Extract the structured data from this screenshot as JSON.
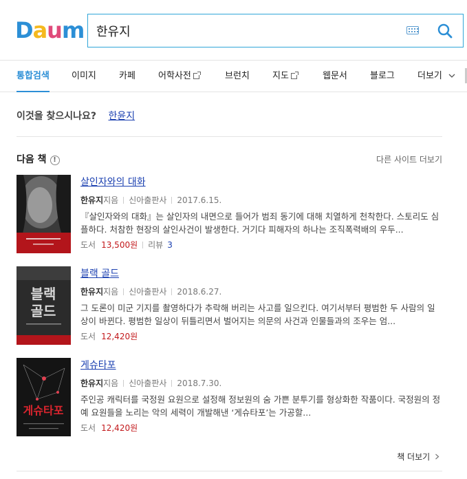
{
  "logo": {
    "letters": [
      "D",
      "a",
      "u",
      "m"
    ],
    "colors": [
      "#2c8fd6",
      "#f5b91f",
      "#e04a7a",
      "#2c8fd6"
    ]
  },
  "search": {
    "value": "한유지",
    "placeholder": ""
  },
  "nav": {
    "items": [
      {
        "label": "통합검색",
        "active": true,
        "external": false
      },
      {
        "label": "이미지",
        "active": false,
        "external": false
      },
      {
        "label": "카페",
        "active": false,
        "external": false
      },
      {
        "label": "어학사전",
        "active": false,
        "external": true
      },
      {
        "label": "브런치",
        "active": false,
        "external": false
      },
      {
        "label": "지도",
        "active": false,
        "external": true
      },
      {
        "label": "웹문서",
        "active": false,
        "external": false
      },
      {
        "label": "블로그",
        "active": false,
        "external": false
      },
      {
        "label": "더보기",
        "active": false,
        "external": false
      }
    ]
  },
  "suggest": {
    "label": "이것을 찾으시나요?",
    "link": "한윤지"
  },
  "section": {
    "title": "다음 책",
    "info_icon": "!",
    "more_sites": "다른 사이트 더보기"
  },
  "books": [
    {
      "title": "살인자와의 대화",
      "author": "한유지",
      "author_suffix": "지음",
      "publisher": "신아출판사",
      "date": "2017.6.15.",
      "desc": "『살인자와의 대화』는 살인자의 내면으로 들어가 범죄 동기에 대해 치열하게 천착한다. 스토리도 심플하다. 처참한 현장의 살인사건이 발생한다. 거기다 피해자의 하나는 조직폭력배의 우두...",
      "price_label": "도서",
      "price": "13,500원",
      "review_label": "리뷰",
      "review_count": "3",
      "cover_bg": "#3a3a3a"
    },
    {
      "title": "블랙 골드",
      "author": "한유지",
      "author_suffix": "지음",
      "publisher": "신아출판사",
      "date": "2018.6.27.",
      "desc": "그 도론이 미군 기지를 촬영하다가 추락해 버리는 사고를 일으킨다. 여기서부터 평범한 두 사람의 일상이 바뀐다. 평범한 일상이 뒤틀리면서 벌어지는 의문의 사건과 인물들과의 조우는 엄...",
      "price_label": "도서",
      "price": "12,420원",
      "review_label": "",
      "review_count": "",
      "cover_bg": "#2b2b2b",
      "cover_text": [
        "블랙",
        "골드"
      ]
    },
    {
      "title": "게슈타포",
      "author": "한유지",
      "author_suffix": "지음",
      "publisher": "신아출판사",
      "date": "2018.7.30.",
      "desc": "주인공 캐릭터를 국정원 요원으로 설정해 정보원의 숨 가쁜 분투기를 형상화한 작품이다. 국정원의 정예 요원들을 노리는 악의 세력이 개발해낸 ‘게슈타포’는 가공할...",
      "price_label": "도서",
      "price": "12,420원",
      "review_label": "",
      "review_count": "",
      "cover_bg": "#141414",
      "cover_text": [
        "게슈타포"
      ]
    }
  ],
  "more_books": "책 더보기"
}
